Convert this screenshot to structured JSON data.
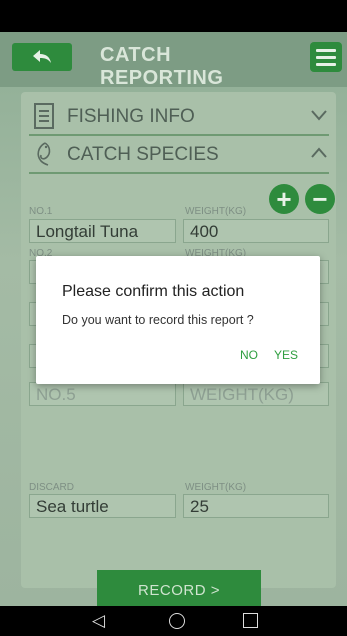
{
  "header": {
    "back_icon": "back-arrow-icon",
    "title": "CATCH REPORTING",
    "menu_icon": "hamburger-menu-icon"
  },
  "sections": {
    "fishing_info": {
      "label": "FISHING INFO",
      "icon": "document-icon",
      "chevron": "chevron-down-icon"
    },
    "catch_species": {
      "label": "CATCH SPECIES",
      "icon": "fish-icon",
      "chevron": "chevron-up-icon"
    }
  },
  "buttons": {
    "add": "+",
    "remove": "−"
  },
  "catch_rows": [
    {
      "no_label": "NO.1",
      "species": "Longtail Tuna",
      "weight_label": "WEIGHT(KG)",
      "weight": "400"
    },
    {
      "no_label": "NO.2",
      "species": "",
      "weight_label": "WEIGHT(KG)",
      "weight": ""
    },
    {
      "no_label": "",
      "species": "NO.5",
      "weight_label": "",
      "weight": "WEIGHT(KG)"
    }
  ],
  "discard": {
    "label": "DISCARD",
    "value": "Sea turtle",
    "weight_label": "WEIGHT(KG)",
    "weight": "25"
  },
  "record_button": "RECORD >",
  "dialog": {
    "title": "Please confirm this action",
    "message": "Do you want to record this report ?",
    "no": "NO",
    "yes": "YES"
  },
  "colors": {
    "brand_green": "#2e8b3d",
    "dialog_button": "#2e9e3f"
  }
}
